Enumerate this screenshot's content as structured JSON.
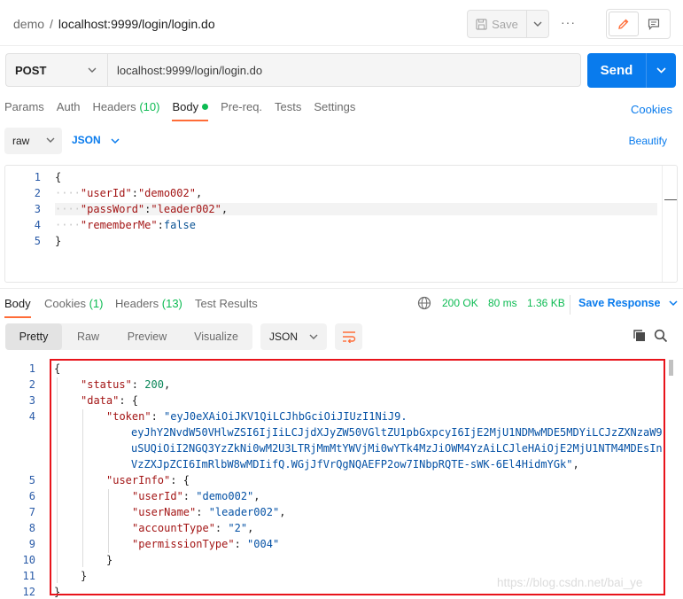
{
  "breadcrumb": {
    "parent": "demo",
    "separator": "/",
    "current": "localhost:9999/login/login.do"
  },
  "toolbar": {
    "save_label": "Save",
    "more_label": "···"
  },
  "request": {
    "method": "POST",
    "url": "localhost:9999/login/login.do",
    "send_label": "Send"
  },
  "request_tabs": {
    "params": "Params",
    "auth": "Auth",
    "headers": "Headers",
    "headers_count": "(10)",
    "body": "Body",
    "prereq": "Pre-req.",
    "tests": "Tests",
    "settings": "Settings",
    "cookies": "Cookies"
  },
  "body_options": {
    "mode": "raw",
    "format": "JSON",
    "beautify": "Beautify"
  },
  "request_body": {
    "line_numbers": [
      "1",
      "2",
      "3",
      "4",
      "5"
    ],
    "open_brace": "{",
    "close_brace": "}",
    "l2_key": "\"userId\"",
    "l2_val": "\"demo002\"",
    "l3_key": "\"passWord\"",
    "l3_val": "\"leader002\"",
    "l4_key": "\"rememberMe\"",
    "l4_val": "false"
  },
  "response_tabs": {
    "body": "Body",
    "cookies": "Cookies",
    "cookies_count": "(1)",
    "headers": "Headers",
    "headers_count": "(13)",
    "test_results": "Test Results"
  },
  "response_status": {
    "status": "200 OK",
    "time": "80 ms",
    "size": "1.36 KB",
    "save_response": "Save Response"
  },
  "view_modes": {
    "pretty": "Pretty",
    "raw": "Raw",
    "preview": "Preview",
    "visualize": "Visualize",
    "format": "JSON"
  },
  "response_body": {
    "line_numbers": [
      "1",
      "2",
      "3",
      "4",
      "",
      "",
      "",
      "5",
      "6",
      "7",
      "8",
      "9",
      "10",
      "11",
      "12"
    ],
    "status_key": "\"status\"",
    "status_val": "200",
    "data_key": "\"data\"",
    "token_key": "\"token\"",
    "token_1": "\"eyJ0eXAiOiJKV1QiLCJhbGciOiJIUzI1NiJ9.",
    "token_2": "eyJhY2NvdW50VHlwZSI6IjIiLCJjdXJyZW50VGltZU1pbGxpcyI6IjE2MjU1NDMwMDE5MDYiLCJzZXNzaW9",
    "token_3": "uSUQiOiI2NGQ3YzZkNi0wM2U3LTRjMmMtYWVjMi0wYTk4MzJiOWM4YzAiLCJleHAiOjE2MjU1NTM4MDEsIn",
    "token_4": "VzZXJpZCI6ImRlbW8wMDIifQ.WGjJfVrQgNQAEFP2ow7INbpRQTE-sWK-6El4HidmYGk\"",
    "userinfo_key": "\"userInfo\"",
    "userid_key": "\"userId\"",
    "userid_val": "\"demo002\"",
    "username_key": "\"userName\"",
    "username_val": "\"leader002\"",
    "accounttype_key": "\"accountType\"",
    "accounttype_val": "\"2\"",
    "permission_key": "\"permissionType\"",
    "permission_val": "\"004\""
  },
  "watermark": "https://blog.csdn.net/bai_ye",
  "colors": {
    "accent": "#097bed",
    "tab_indicator": "#ff6c37",
    "success": "#0cbb52",
    "highlight_box": "#e8141b"
  }
}
